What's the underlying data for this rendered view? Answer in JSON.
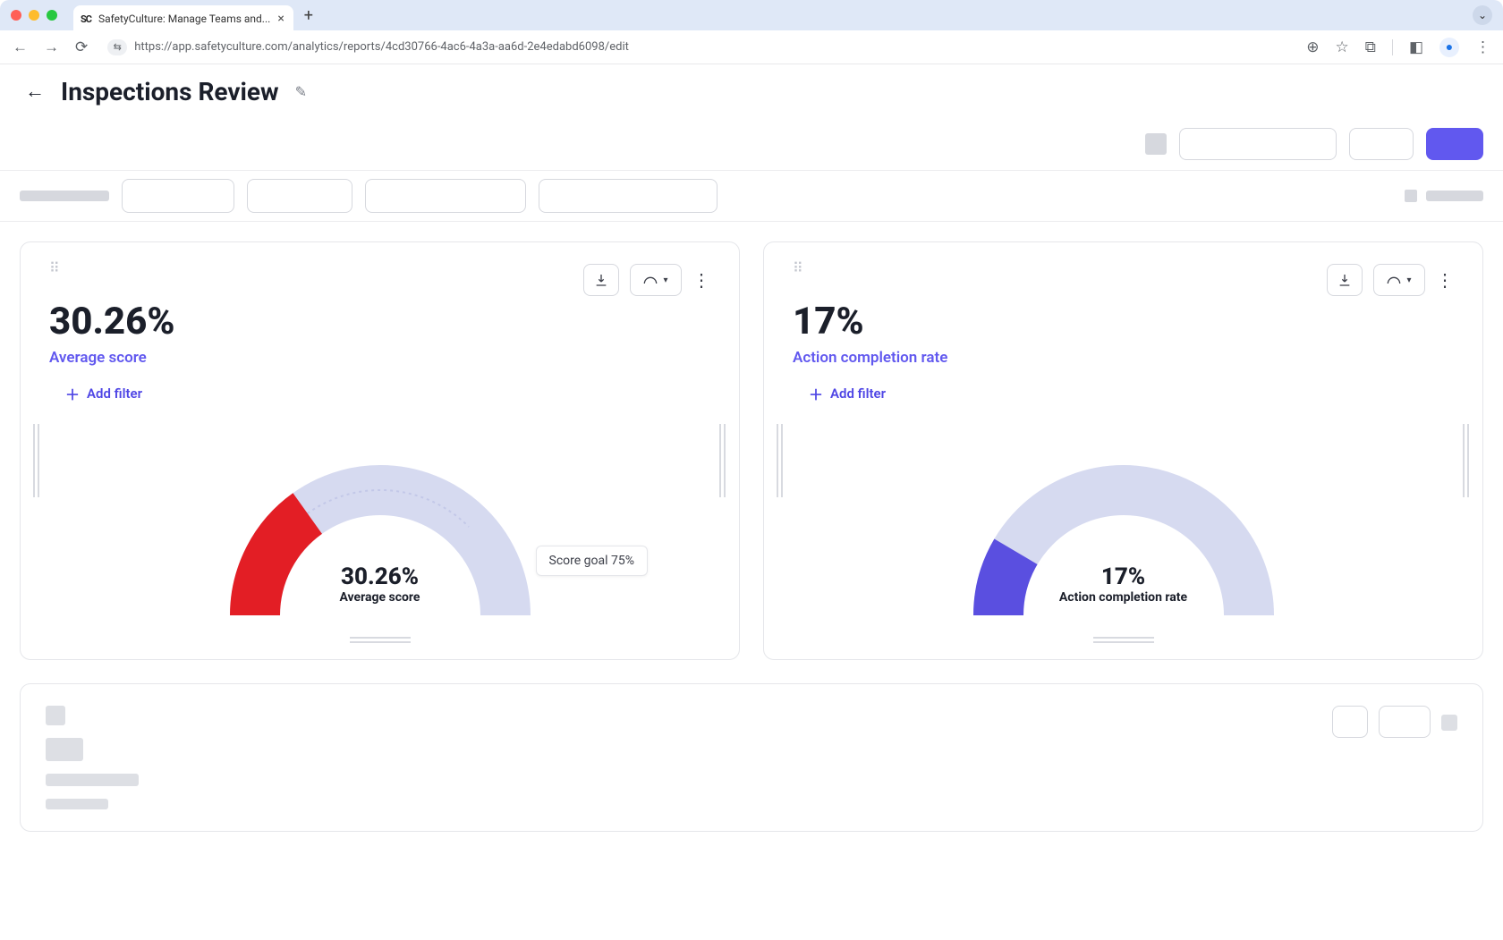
{
  "browser": {
    "tab_title": "SafetyCulture: Manage Teams and...",
    "url": "https://app.safetyculture.com/analytics/reports/4cd30766-4ac6-4a3a-aa6d-2e4edabd6098/edit"
  },
  "page": {
    "title": "Inspections Review"
  },
  "cards": [
    {
      "value_text": "30.26%",
      "label": "Average score",
      "add_filter_label": "Add filter",
      "gauge_value_text": "30.26%",
      "gauge_label": "Average score",
      "tooltip": "Score goal 75%"
    },
    {
      "value_text": "17%",
      "label": "Action completion rate",
      "add_filter_label": "Add filter",
      "gauge_value_text": "17%",
      "gauge_label": "Action completion rate"
    }
  ],
  "chart_data": [
    {
      "type": "gauge",
      "title": "Average score",
      "value": 30.26,
      "min": 0,
      "max": 100,
      "unit": "%",
      "goal": 75,
      "color": "#e31e25",
      "track_color": "#d6daf0"
    },
    {
      "type": "gauge",
      "title": "Action completion rate",
      "value": 17,
      "min": 0,
      "max": 100,
      "unit": "%",
      "color": "#5a4fe0",
      "track_color": "#d6daf0"
    }
  ]
}
